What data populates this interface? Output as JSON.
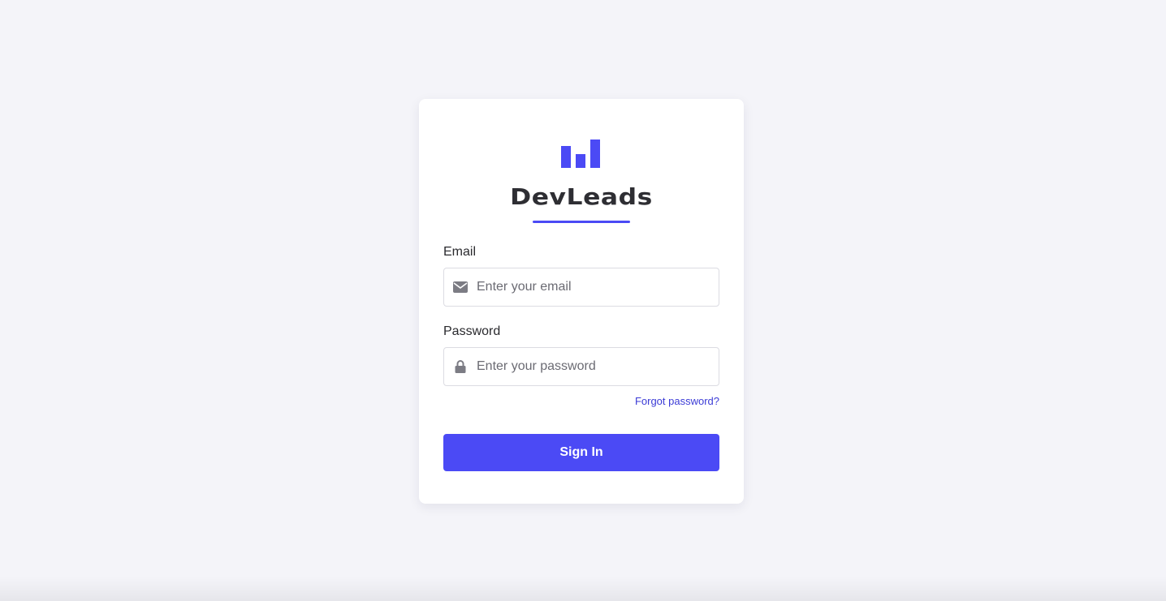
{
  "brand": {
    "name": "DevLeads",
    "logo_icon": "bar-chart-icon",
    "accent_color": "#4b4af5"
  },
  "form": {
    "email": {
      "label": "Email",
      "placeholder": "Enter your email",
      "value": "",
      "icon": "envelope-icon"
    },
    "password": {
      "label": "Password",
      "placeholder": "Enter your password",
      "value": "",
      "icon": "lock-icon"
    },
    "forgot_label": "Forgot password?",
    "submit_label": "Sign In"
  }
}
